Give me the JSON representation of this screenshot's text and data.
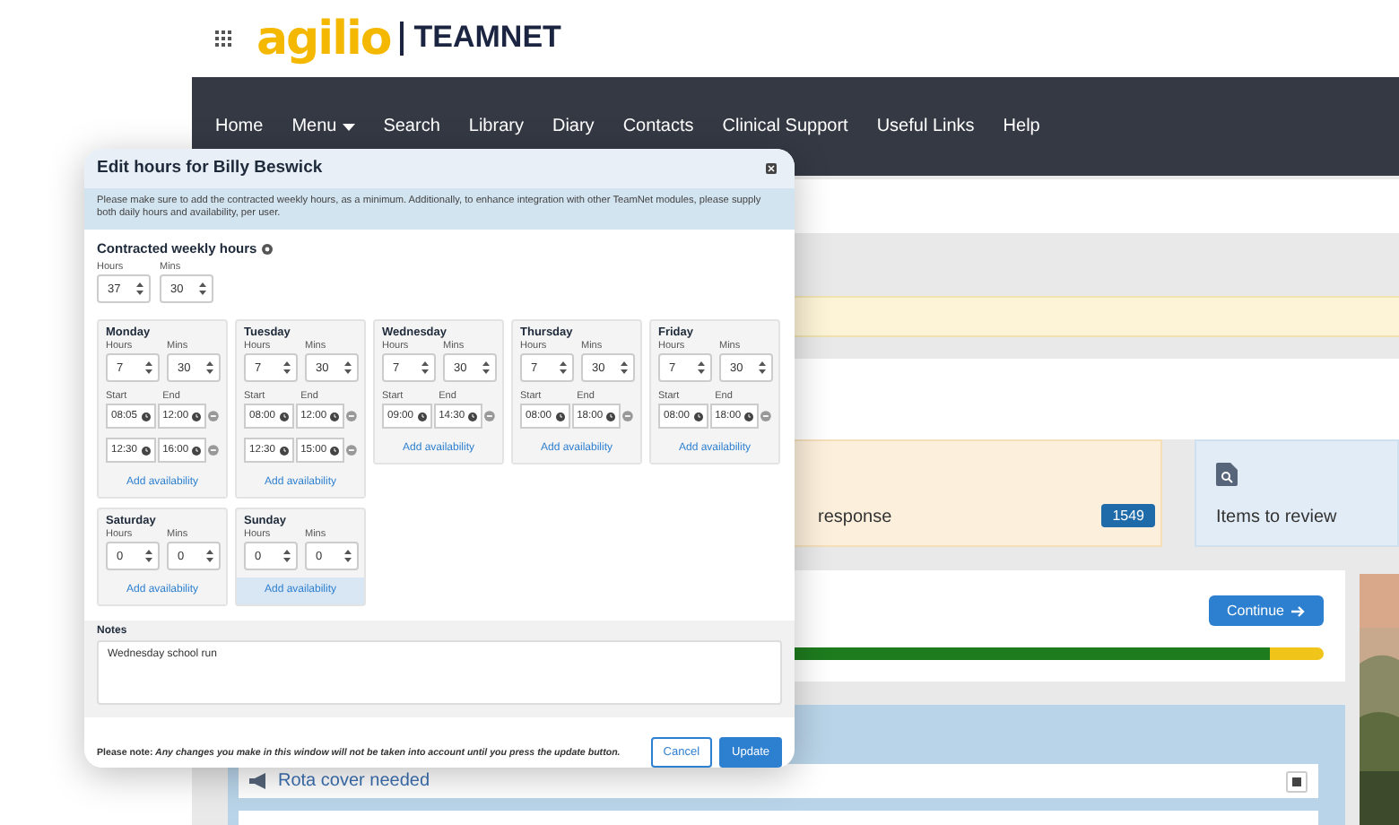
{
  "header": {
    "logo_brand": "agilio",
    "logo_product": "TEAMNET"
  },
  "nav": [
    {
      "label": "Home",
      "dropdown": false
    },
    {
      "label": "Menu",
      "dropdown": true
    },
    {
      "label": "Search",
      "dropdown": false
    },
    {
      "label": "Library",
      "dropdown": false
    },
    {
      "label": "Diary",
      "dropdown": false
    },
    {
      "label": "Contacts",
      "dropdown": false
    },
    {
      "label": "Clinical Support",
      "dropdown": false
    },
    {
      "label": "Useful Links",
      "dropdown": false
    },
    {
      "label": "Help",
      "dropdown": false
    }
  ],
  "cards": [
    {
      "kind": "count",
      "label": "response",
      "badge": "1549"
    },
    {
      "kind": "review",
      "label": "Items to review"
    }
  ],
  "progress": {
    "button": "Continue",
    "level": 0.95
  },
  "tasks": [
    {
      "label": "Rota cover needed"
    }
  ],
  "dialog": {
    "title": "Edit hours for Billy Beswick",
    "info": "Please make sure to add the contracted weekly hours, as a minimum. Additionally, to enhance integration with other TeamNet modules, please supply both daily hours and availability, per user.",
    "weekly_label": "Contracted weekly hours",
    "hours_label": "Hours",
    "mins_label": "Mins",
    "hours": "37",
    "mins": "30",
    "days": [
      {
        "name": "Monday",
        "hours_label": "Hours",
        "mins_label": "Mins",
        "hours": "7",
        "mins": "30",
        "hovered": false,
        "start_label": "Start",
        "end_label": "End",
        "availability": [
          {
            "start": "08:05",
            "end": "12:00"
          },
          {
            "start": "12:30",
            "end": "16:00"
          }
        ],
        "add": "Add availability"
      },
      {
        "name": "Tuesday",
        "hours_label": "Hours",
        "mins_label": "Mins",
        "hours": "7",
        "mins": "30",
        "hovered": false,
        "start_label": "Start",
        "end_label": "End",
        "availability": [
          {
            "start": "08:00",
            "end": "12:00"
          },
          {
            "start": "12:30",
            "end": "15:00"
          }
        ],
        "add": "Add availability"
      },
      {
        "name": "Wednesday",
        "hours_label": "Hours",
        "mins_label": "Mins",
        "hours": "7",
        "mins": "30",
        "hovered": false,
        "start_label": "Start",
        "end_label": "End",
        "availability": [
          {
            "start": "09:00",
            "end": "14:30"
          }
        ],
        "add": "Add availability"
      },
      {
        "name": "Thursday",
        "hours_label": "Hours",
        "mins_label": "Mins",
        "hours": "7",
        "mins": "30",
        "hovered": false,
        "start_label": "Start",
        "end_label": "End",
        "availability": [
          {
            "start": "08:00",
            "end": "18:00"
          }
        ],
        "add": "Add availability"
      },
      {
        "name": "Friday",
        "hours_label": "Hours",
        "mins_label": "Mins",
        "hours": "7",
        "mins": "30",
        "hovered": false,
        "start_label": "Start",
        "end_label": "End",
        "availability": [
          {
            "start": "08:00",
            "end": "18:00"
          }
        ],
        "add": "Add availability"
      },
      {
        "name": "Saturday",
        "hours_label": "Hours",
        "mins_label": "Mins",
        "hours": "0",
        "mins": "0",
        "hovered": false,
        "add": "Add availability"
      },
      {
        "name": "Sunday",
        "hours_label": "Hours",
        "mins_label": "Mins",
        "hours": "0",
        "mins": "0",
        "hovered": true,
        "add": "Add availability"
      }
    ],
    "notes_label": "Notes",
    "notes": "Wednesday school run",
    "footer_bold": "Please note:",
    "footer_note": "Any changes you make in this window will not be taken into account until you press the update button.",
    "buttons": [
      {
        "label": "Cancel",
        "kind": "secondary"
      },
      {
        "label": "Update",
        "kind": "primary"
      }
    ]
  }
}
